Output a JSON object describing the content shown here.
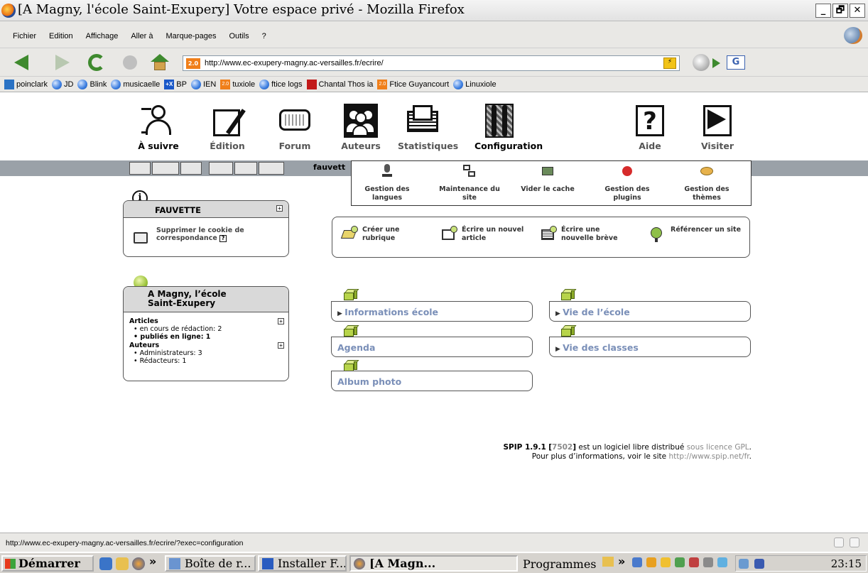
{
  "window": {
    "title": "[A Magny, l'école Saint-Exupery] Votre espace privé - Mozilla Firefox",
    "buttons": [
      "_",
      "🗗",
      "✕"
    ]
  },
  "menubar": {
    "items": [
      {
        "label": "Fichier"
      },
      {
        "label": "Edition"
      },
      {
        "label": "Affichage"
      },
      {
        "label": "Aller à"
      },
      {
        "label": "Marque-pages"
      },
      {
        "label": "Outils"
      },
      {
        "label": "?"
      }
    ]
  },
  "navbar": {
    "url": "http://www.ec-exupery-magny.ac-versailles.fr/ecrire/",
    "favicon_text": "2.0",
    "google": "G"
  },
  "bookmarks": [
    {
      "label": "poinclark",
      "icon": "page-icon"
    },
    {
      "label": "JD",
      "icon": "globe-icon"
    },
    {
      "label": "Blink",
      "icon": "globe-icon"
    },
    {
      "label": "musicaelle",
      "icon": "globe-icon"
    },
    {
      "label": "BP",
      "icon": "bp-icon",
      "badge": "+X"
    },
    {
      "label": "IEN",
      "icon": "globe-icon"
    },
    {
      "label": "tuxiole",
      "icon": "spip-icon",
      "badge": "2.0"
    },
    {
      "label": "ftice logs",
      "icon": "globe-icon"
    },
    {
      "label": "Chantal Thos ia",
      "icon": "red-square-icon"
    },
    {
      "label": "Ftice Guyancourt",
      "icon": "spip-icon",
      "badge": "2.0"
    },
    {
      "label": "Linuxiole",
      "icon": "globe-icon"
    }
  ],
  "spip_nav": {
    "items": [
      {
        "label": "À suivre",
        "icon": "a-suivre-icon"
      },
      {
        "label": "Édition",
        "icon": "edition-icon"
      },
      {
        "label": "Forum",
        "icon": "forum-icon"
      },
      {
        "label": "Auteurs",
        "icon": "auteurs-icon"
      },
      {
        "label": "Statistiques",
        "icon": "statistiques-icon"
      },
      {
        "label": "Configuration",
        "icon": "configuration-icon"
      },
      {
        "label": "Aide",
        "icon": "aide-icon"
      },
      {
        "label": "Visiter",
        "icon": "visiter-icon"
      }
    ],
    "aide_glyph": "?",
    "user": "fauvett"
  },
  "config_menu": {
    "items": [
      {
        "label": "Gestion des langues",
        "icon": "microphone-icon"
      },
      {
        "label": "Maintenance du site",
        "icon": "server-icon"
      },
      {
        "label": "Vider le cache",
        "icon": "cache-icon"
      },
      {
        "label": "Gestion des plugins",
        "icon": "plug-icon"
      },
      {
        "label": "Gestion des thèmes",
        "icon": "palette-icon"
      }
    ]
  },
  "user_box": {
    "info_glyph": "i",
    "name": "FAUVETTE",
    "action": "Supprimer le cookie de correspondance",
    "help": "?"
  },
  "site_box": {
    "title": "A Magny, l’école Saint-Exupery",
    "articles_heading": "Articles",
    "articles": [
      {
        "label": "en cours de rédaction: 2",
        "bold": false
      },
      {
        "label": "publiés en ligne: 1",
        "bold": true
      }
    ],
    "auteurs_heading": "Auteurs",
    "auteurs": [
      {
        "label": "Administrateurs: 3"
      },
      {
        "label": "Rédacteurs: 1"
      }
    ]
  },
  "actions": [
    {
      "label": "Créer une rubrique",
      "icon": "rubrique-add-icon"
    },
    {
      "label": "Écrire un nouvel article",
      "icon": "article-add-icon"
    },
    {
      "label": "Écrire une nouvelle brève",
      "icon": "breve-add-icon"
    },
    {
      "label": "Référencer un site",
      "icon": "site-add-icon"
    }
  ],
  "rubriques": [
    {
      "label": "Informations école",
      "expandable": true
    },
    {
      "label": "Vie de l’école",
      "expandable": true
    },
    {
      "label": "Agenda",
      "expandable": false
    },
    {
      "label": "Vie des classes",
      "expandable": true
    },
    {
      "label": "Album photo",
      "expandable": false
    }
  ],
  "footer": {
    "spip": "SPIP 1.9.1",
    "build_open": "[",
    "build": "7502",
    "build_close": "]",
    "text1": "est un logiciel libre distribué",
    "licence": "sous licence GPL",
    "period": ".",
    "text2": "Pour plus d’informations, voir le site",
    "link": "http://www.spip.net/fr",
    "period2": "."
  },
  "statusbar": {
    "text": "http://www.ec-exupery-magny.ac-versailles.fr/ecrire/?exec=configuration"
  },
  "taskbar": {
    "start": "Démarrer",
    "chevron": "»",
    "tasks": [
      {
        "label": "Boîte de r...",
        "pressed": false
      },
      {
        "label": "Installer F...",
        "pressed": false
      },
      {
        "label": "[A Magn...",
        "pressed": true
      }
    ],
    "programmes": "Programmes",
    "clock": "23:15"
  },
  "colors": {
    "rubrique_text": "#7a8fb8",
    "graybar": "#9aa1a8",
    "box_head": "#d9d9d9"
  }
}
